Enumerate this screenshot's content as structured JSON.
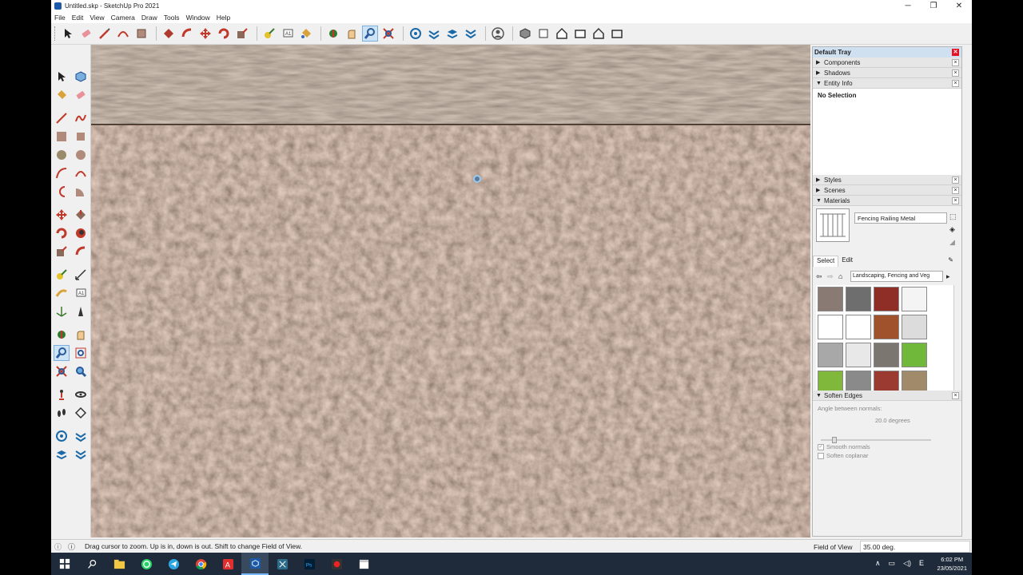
{
  "window": {
    "title": "Untitled.skp - SketchUp Pro 2021",
    "minimize": "─",
    "maximize": "❐",
    "close": "✕"
  },
  "menu": [
    "File",
    "Edit",
    "View",
    "Camera",
    "Draw",
    "Tools",
    "Window",
    "Help"
  ],
  "tray": {
    "title": "Default Tray",
    "panels": {
      "components": "Components",
      "shadows": "Shadows",
      "entity_info": "Entity Info",
      "styles": "Styles",
      "scenes": "Scenes",
      "materials": "Materials",
      "soften_edges": "Soften Edges"
    },
    "entity_info_text": "No Selection",
    "materials": {
      "current_name": "Fencing Railing Metal",
      "tab_select": "Select",
      "tab_edit": "Edit",
      "collection": "Landscaping, Fencing and Veg",
      "swatches": [
        "#8a7a74",
        "#6e6e6e",
        "#8e2e26",
        "#f4f4f4",
        "#ffffff",
        "#ffffff",
        "#a0522d",
        "#dcdcdc",
        "#a8a8a8",
        "#e8e8e8",
        "#7c7670",
        "#6fb83a",
        "#7fb83a",
        "#8a8a8a",
        "#9b3a30",
        "#a08a6a"
      ]
    },
    "soften": {
      "angle_label": "Angle between normals:",
      "angle_value": "20.0  degrees",
      "smooth_label": "Smooth normals",
      "coplanar_label": "Soften coplanar"
    }
  },
  "status": {
    "hint": "Drag cursor to zoom.  Up is in, down is out. Shift to change Field of View.",
    "fov_label": "Field of View",
    "fov_value": "35.00 deg."
  },
  "taskbar": {
    "time": "6:02 PM",
    "date": "23/05/2021",
    "lang": "E"
  },
  "colors": {
    "accent": "#cfe0f1",
    "taskbar": "#1f2b3a",
    "ground": "#6f5546"
  }
}
